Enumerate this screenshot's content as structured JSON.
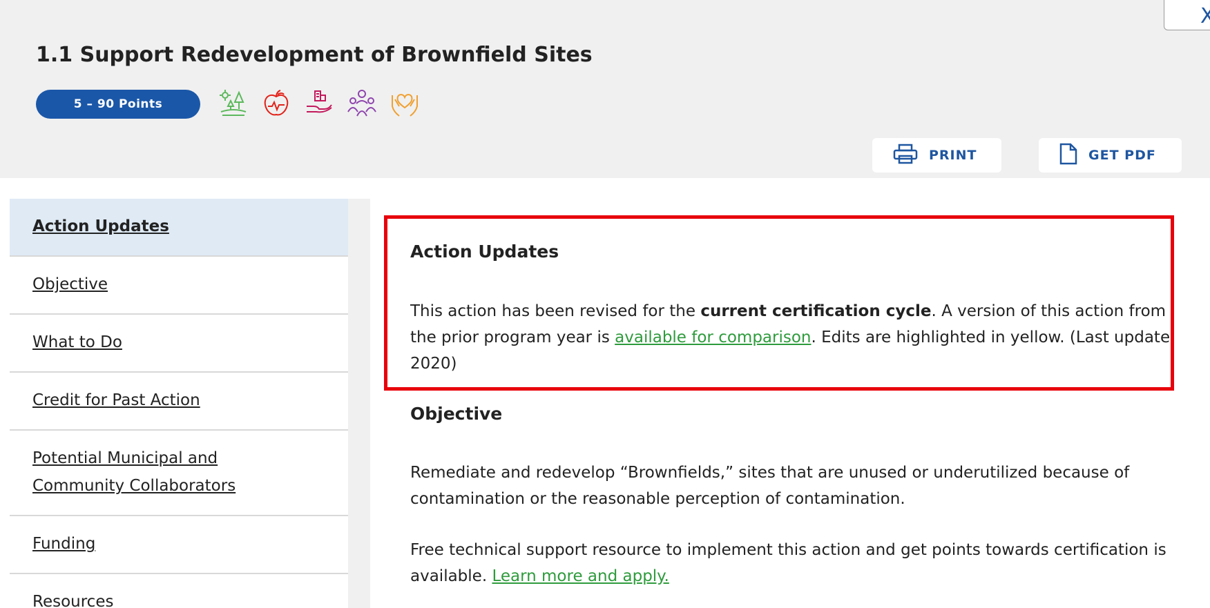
{
  "header": {
    "title": "1.1 Support Redevelopment of Brownfield Sites",
    "points_badge": "5 – 90 Points",
    "close_label": "X",
    "category_icons": [
      {
        "name": "landscape-tree-icon",
        "color": "#5cb85c"
      },
      {
        "name": "health-apple-icon",
        "color": "#e2231a"
      },
      {
        "name": "hand-buildings-icon",
        "color": "#c2185b"
      },
      {
        "name": "people-group-icon",
        "color": "#8e44ad"
      },
      {
        "name": "hands-heart-icon",
        "color": "#f0a030"
      }
    ],
    "print_label": "PRINT",
    "pdf_label": "GET PDF"
  },
  "sidebar": {
    "items": [
      {
        "label": "Action Updates",
        "active": true
      },
      {
        "label": "Objective"
      },
      {
        "label": "What to Do"
      },
      {
        "label": "Credit for Past Action"
      },
      {
        "label_line1": "Potential Municipal and",
        "label_line2": "Community Collaborators"
      },
      {
        "label": "Funding"
      },
      {
        "label": "Resources"
      }
    ]
  },
  "main": {
    "action_updates": {
      "heading": "Action Updates",
      "text1": "This action has been revised for the ",
      "bold": "current certification cycle",
      "text2": ". A version of this action from the prior program year is ",
      "link": "available for comparison",
      "text3": ". Edits are highlighted in yellow. (Last update 2020)"
    },
    "objective": {
      "heading": "Objective",
      "para1": "Remediate and redevelop “Brownfields,” sites that are unused or underutilized because of contamination or the reasonable perception of contamination.",
      "para2_text": "Free technical support resource to implement this action and get points towards certification is available. ",
      "para2_link": "Learn more and apply."
    }
  },
  "colors": {
    "brand_blue": "#1a57a8",
    "link_green": "#2e9b3c",
    "highlight_red": "#e8000b",
    "active_item_bg": "#dfeaf5"
  }
}
